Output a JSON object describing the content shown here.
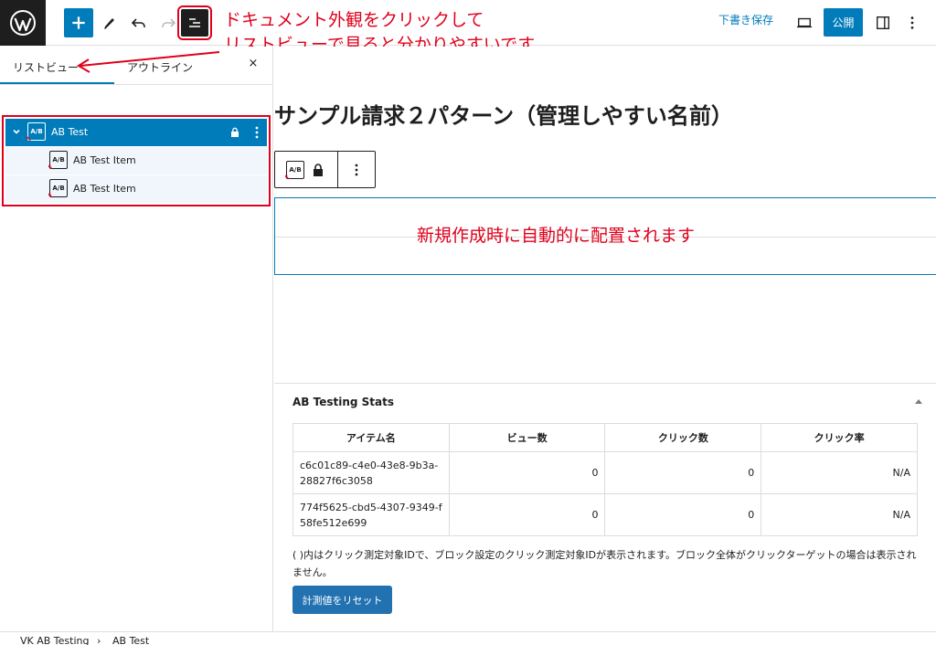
{
  "toolbar": {
    "draft_label": "下書き保存",
    "publish_label": "公開"
  },
  "annotations": {
    "top_line1": "ドキュメント外観をクリックして",
    "top_line2": "リストビューで見ると分かりやすいです",
    "middle": "新規作成時に自動的に配置されます",
    "color": "#e0001b"
  },
  "sidebar": {
    "tabs": [
      {
        "label": "リストビュー",
        "active": true
      },
      {
        "label": "アウトライン",
        "active": false
      }
    ],
    "close_symbol": "×",
    "tree": {
      "parent": {
        "label": "AB Test",
        "icon": "ab-test-icon",
        "icon_text": "A/B"
      },
      "children": [
        {
          "label": "AB Test Item",
          "icon_text": "A/B"
        },
        {
          "label": "AB Test Item",
          "icon_text": "A/B"
        }
      ]
    }
  },
  "editor": {
    "post_title": "サンプル請求２パターン（管理しやすい名前）",
    "block_icon_text": "A/B"
  },
  "metabox": {
    "title": "AB Testing Stats",
    "columns": [
      "アイテム名",
      "ビュー数",
      "クリック数",
      "クリック率"
    ],
    "rows": [
      {
        "name": "c6c01c89-c4e0-43e8-9b3a-28827f6c3058",
        "views": "0",
        "clicks": "0",
        "rate": "N/A"
      },
      {
        "name": "774f5625-cbd5-4307-9349-f58fe512e699",
        "views": "0",
        "clicks": "0",
        "rate": "N/A"
      }
    ],
    "note": "( )内はクリック測定対象IDで、ブロック設定のクリック測定対象IDが表示されます。ブロック全体がクリックターゲットの場合は表示されません。",
    "reset_label": "計測値をリセット"
  },
  "footer": {
    "breadcrumb": [
      "VK AB Testing",
      "AB Test"
    ],
    "separator": "›"
  },
  "colors": {
    "accent": "#007cba",
    "dark": "#1e1e1e",
    "annotation": "#e0001b"
  }
}
